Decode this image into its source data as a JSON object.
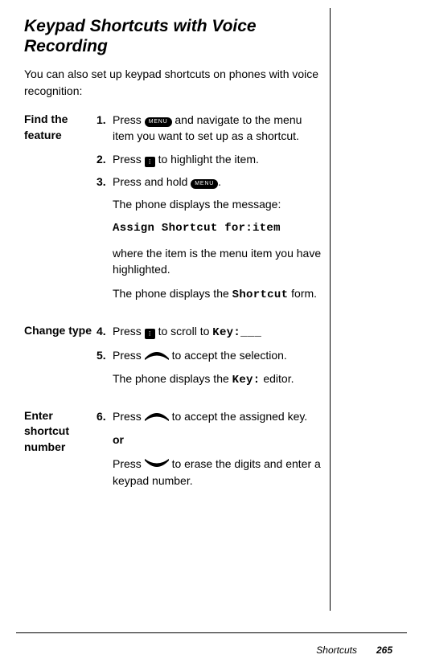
{
  "heading": "Keypad Shortcuts with Voice Recording",
  "intro": "You can also set up keypad shortcuts on phones with voice recognition:",
  "icons": {
    "menu_label": "MENU",
    "nav_glyph": "⁝"
  },
  "sections": {
    "find": {
      "label": "Find the feature",
      "step1": {
        "num": "1.",
        "before": "Press ",
        "after": " and navigate to the menu item you want to set up as a shortcut."
      },
      "step2": {
        "num": "2.",
        "before": "Press ",
        "after": " to highlight the item."
      },
      "step3": {
        "num": "3.",
        "before": "Press and hold ",
        "after": "."
      },
      "msg_line": "The phone displays the message:",
      "assign_code": "Assign Shortcut for:item",
      "where": "where the item is the menu item you have highlighted.",
      "form_before": "The phone displays the ",
      "form_code": "Shortcut",
      "form_after": " form."
    },
    "change": {
      "label": "Change type",
      "step4": {
        "num": "4.",
        "before": "Press ",
        "mid": " to scroll to ",
        "code": "Key:___"
      },
      "step5": {
        "num": "5.",
        "before": "Press ",
        "after": " to accept the selection."
      },
      "editor_before": "The phone displays the ",
      "editor_code": "Key:",
      "editor_after": " editor."
    },
    "enter": {
      "label": "Enter shortcut number",
      "step6": {
        "num": "6.",
        "before": "Press ",
        "after": " to accept the assigned key."
      },
      "or": "or",
      "alt": {
        "before": "Press ",
        "after": " to erase the digits and enter a keypad number."
      }
    }
  },
  "footer": {
    "section": "Shortcuts",
    "page": "265"
  }
}
